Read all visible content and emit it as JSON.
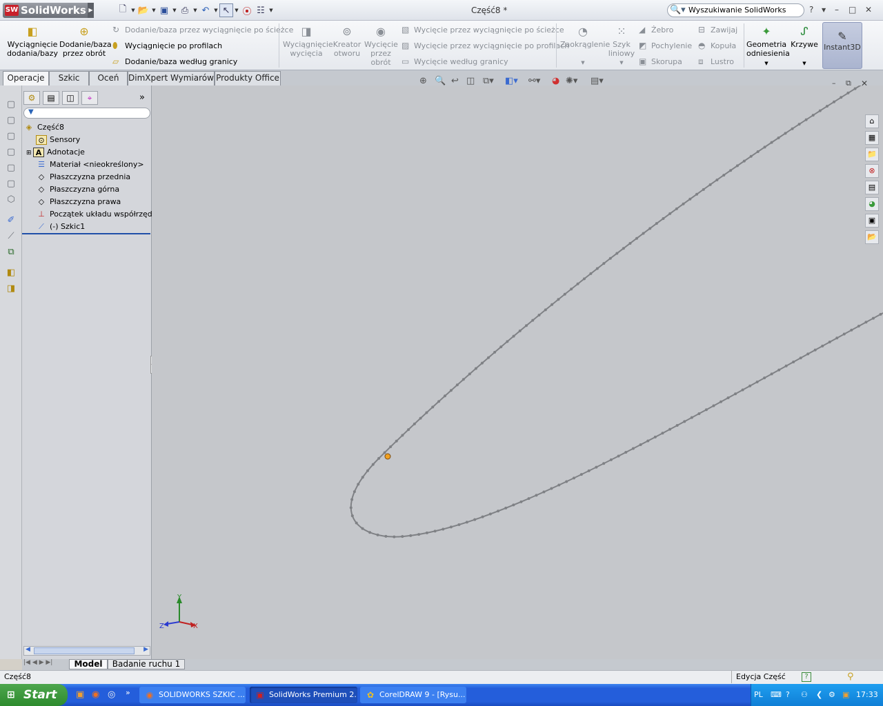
{
  "app": {
    "name": "SolidWorks",
    "sw_badge": "SW",
    "doc_title": "Część8 *"
  },
  "search": {
    "value": "Wyszukiwanie SolidWorks"
  },
  "ribbon": {
    "extrude_boss": "Wyciągnięcie dodania/bazy",
    "revolve_boss": "Dodanie/baza przez obrót",
    "sweep_boss": "Dodanie/baza przez wyciągnięcie po ścieżce",
    "loft_boss": "Wyciągnięcie po profilach",
    "boundary_boss": "Dodanie/baza według granicy",
    "extrude_cut": "Wyciągnięcie wycięcia",
    "hole_wizard": "Kreator otworu",
    "revolve_cut": "Wycięcie przez obrót",
    "sweep_cut": "Wycięcie przez wyciągnięcie po ścieżce",
    "loft_cut": "Wycięcie przez wyciągnięcie po profilach",
    "boundary_cut": "Wycięcie według granicy",
    "fillet": "Zaokrąglenie",
    "linear_pattern": "Szyk liniowy",
    "rib": "Żebro",
    "draft": "Pochylenie",
    "shell": "Skorupa",
    "wrap": "Zawijaj",
    "dome": "Kopuła",
    "mirror": "Lustro",
    "ref_geometry": "Geometria odniesienia",
    "curves": "Krzywe",
    "instant3d": "Instant3D"
  },
  "tabs": [
    "Operacje",
    "Szkic",
    "Oceń",
    "DimXpert Wymiarów",
    "Produkty Office"
  ],
  "tree": {
    "root": "Część8",
    "items": [
      "Sensory",
      "Adnotacje",
      "Materiał <nieokreślony>",
      "Płaszczyzna przednia",
      "Płaszczyzna górna",
      "Płaszczyzna prawa",
      "Początek układu współrzędnych",
      "(-) Szkic1"
    ]
  },
  "triad": {
    "y": "Y",
    "x": "X",
    "z": "Z"
  },
  "bottom_tabs": [
    "Model",
    "Badanie ruchu 1"
  ],
  "status": {
    "left": "Część8",
    "mode": "Edycja Część"
  },
  "taskbar": {
    "start": "Start",
    "buttons": [
      "SOLIDWORKS SZKIC ...",
      "SolidWorks Premium 2...",
      "CorelDRAW 9 - [Rysu..."
    ],
    "lang": "PL",
    "time": "17:33"
  },
  "colors": {
    "canvas": "#c5c7cb",
    "curve": "#7f8185",
    "point": "#f0a020"
  }
}
